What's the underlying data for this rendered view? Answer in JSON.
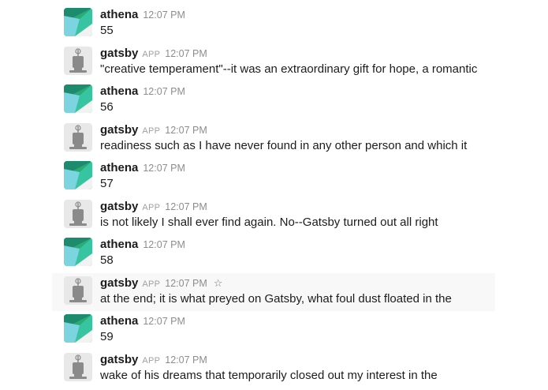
{
  "messages": [
    {
      "author": "athena",
      "time": "12:07 PM",
      "text": "55"
    },
    {
      "author": "gatsby",
      "badge": "APP",
      "time": "12:07 PM",
      "text": "\"creative temperament\"--it was an extraordinary gift for hope, a romantic"
    },
    {
      "author": "athena",
      "time": "12:07 PM",
      "text": "56"
    },
    {
      "author": "gatsby",
      "badge": "APP",
      "time": "12:07 PM",
      "text": "readiness such as I have never found in any other person and which it"
    },
    {
      "author": "athena",
      "time": "12:07 PM",
      "text": "57"
    },
    {
      "author": "gatsby",
      "badge": "APP",
      "time": "12:07 PM",
      "text": "is not likely I shall ever find again. No--Gatsby turned out all right"
    },
    {
      "author": "athena",
      "time": "12:07 PM",
      "text": "58"
    },
    {
      "author": "gatsby",
      "badge": "APP",
      "time": "12:07 PM",
      "text": "at the end; it is what preyed on Gatsby, what foul dust floated in the",
      "star_icon": "star-outline-icon"
    },
    {
      "author": "athena",
      "time": "12:07 PM",
      "text": "59"
    },
    {
      "author": "gatsby",
      "badge": "APP",
      "time": "12:07 PM",
      "text": "wake of his dreams that temporarily closed out my interest in the"
    }
  ],
  "colors": {
    "athena_avatar": [
      "#2bac76",
      "#1e8a6e",
      "#36c5a0",
      "#7cd4e0"
    ],
    "gatsby_avatar_bg": "#e8e8e8",
    "gatsby_avatar_device": "#8a8a8a",
    "hover_bg": "#f8f8f8"
  }
}
